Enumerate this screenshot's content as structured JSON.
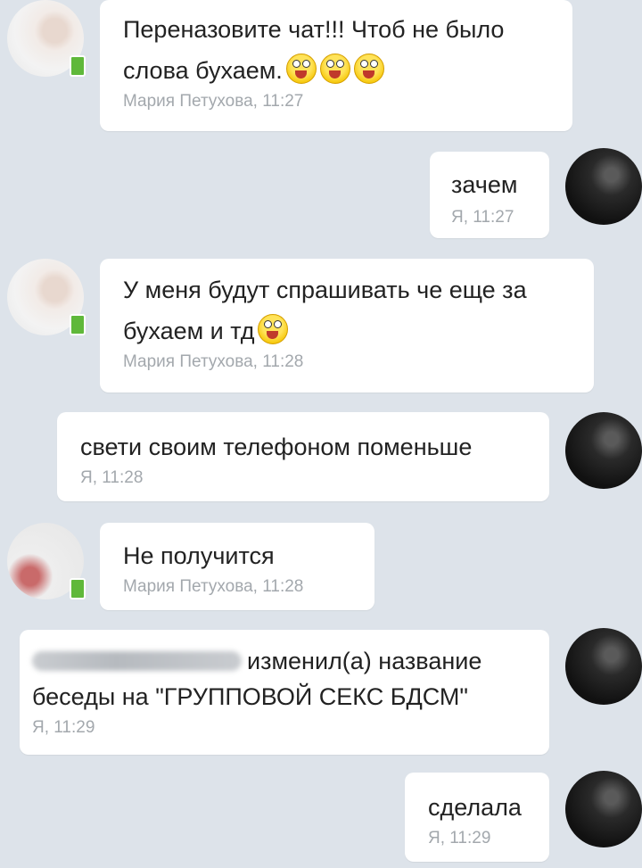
{
  "colors": {
    "background": "#dde3ea",
    "bubble": "#ffffff",
    "meta_text": "#a3a8ad",
    "online_badge": "#5fb83a"
  },
  "messages": [
    {
      "side": "left",
      "lines": [
        "Переназовите чат!!! Чтоб не было",
        "слова бухаем."
      ],
      "emoji_count": 3,
      "meta": "Мария Петухова, 11:27"
    },
    {
      "side": "right",
      "lines": [
        "зачем"
      ],
      "meta": "Я, 11:27"
    },
    {
      "side": "left",
      "lines": [
        "У меня будут спрашивать че еще за",
        "бухаем и тд"
      ],
      "emoji_count": 1,
      "meta": "Мария Петухова, 11:28"
    },
    {
      "side": "right",
      "lines": [
        "свети своим телефоном поменьше"
      ],
      "meta": "Я, 11:28"
    },
    {
      "side": "left",
      "lines": [
        "Не получится"
      ],
      "meta": "Мария Петухова, 11:28"
    },
    {
      "side": "right",
      "lines": [
        "изменил(а) название",
        "беседы на \"ГРУППОВОЙ СЕКС БДСМ\""
      ],
      "meta": "Я, 11:29"
    },
    {
      "side": "right",
      "lines": [
        "сделала"
      ],
      "meta": "Я, 11:29"
    }
  ],
  "icons": {
    "emoji": "laughing-emoji-icon",
    "online": "mobile-online-icon"
  }
}
